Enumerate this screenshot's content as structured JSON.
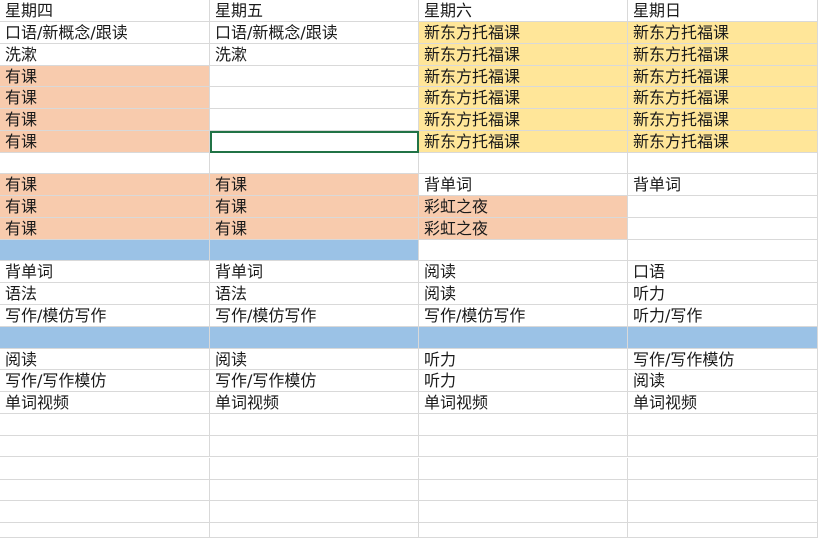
{
  "colors": {
    "orange": "#f8cbad",
    "yellow": "#ffe699",
    "blue": "#9bc2e6",
    "grid": "#d9d9d9"
  },
  "headers": [
    "星期四",
    "星期五",
    "星期六",
    "星期日"
  ],
  "rows": [
    {
      "cells": [
        "口语/新概念/跟读",
        "口语/新概念/跟读",
        "新东方托福课",
        "新东方托福课"
      ],
      "fills": [
        "",
        "",
        "yellow",
        "yellow"
      ]
    },
    {
      "cells": [
        "洗漱",
        "洗漱",
        "新东方托福课",
        "新东方托福课"
      ],
      "fills": [
        "",
        "",
        "yellow",
        "yellow"
      ]
    },
    {
      "cells": [
        "有课",
        "",
        "新东方托福课",
        "新东方托福课"
      ],
      "fills": [
        "orange",
        "",
        "yellow",
        "yellow"
      ]
    },
    {
      "cells": [
        "有课",
        "",
        "新东方托福课",
        "新东方托福课"
      ],
      "fills": [
        "orange",
        "",
        "yellow",
        "yellow"
      ]
    },
    {
      "cells": [
        "有课",
        "",
        "新东方托福课",
        "新东方托福课"
      ],
      "fills": [
        "orange",
        "",
        "yellow",
        "yellow"
      ]
    },
    {
      "cells": [
        "有课",
        "",
        "新东方托福课",
        "新东方托福课"
      ],
      "fills": [
        "orange",
        "",
        "yellow",
        "yellow"
      ]
    },
    {
      "cells": [
        "",
        "",
        "",
        ""
      ],
      "fills": [
        "",
        "",
        "",
        ""
      ]
    },
    {
      "cells": [
        "有课",
        "有课",
        "背单词",
        "背单词"
      ],
      "fills": [
        "orange",
        "orange",
        "",
        ""
      ]
    },
    {
      "cells": [
        "有课",
        "有课",
        "彩虹之夜",
        ""
      ],
      "fills": [
        "orange",
        "orange",
        "orange",
        ""
      ]
    },
    {
      "cells": [
        "有课",
        "有课",
        "彩虹之夜",
        ""
      ],
      "fills": [
        "orange",
        "orange",
        "orange",
        ""
      ]
    },
    {
      "cells": [
        "",
        "",
        "",
        ""
      ],
      "fills": [
        "blue",
        "blue",
        "",
        ""
      ]
    },
    {
      "cells": [
        "背单词",
        "背单词",
        "阅读",
        "口语"
      ],
      "fills": [
        "",
        "",
        "",
        ""
      ]
    },
    {
      "cells": [
        "语法",
        "语法",
        "阅读",
        "听力"
      ],
      "fills": [
        "",
        "",
        "",
        ""
      ]
    },
    {
      "cells": [
        "写作/模仿写作",
        "写作/模仿写作",
        "写作/模仿写作",
        "听力/写作"
      ],
      "fills": [
        "",
        "",
        "",
        ""
      ]
    },
    {
      "cells": [
        "",
        "",
        "",
        ""
      ],
      "fills": [
        "blue",
        "blue",
        "blue",
        "blue"
      ]
    },
    {
      "cells": [
        "阅读",
        "阅读",
        "听力",
        "写作/写作模仿"
      ],
      "fills": [
        "",
        "",
        "",
        ""
      ]
    },
    {
      "cells": [
        "写作/写作模仿",
        "写作/写作模仿",
        "听力",
        "阅读"
      ],
      "fills": [
        "",
        "",
        "",
        ""
      ]
    },
    {
      "cells": [
        "单词视频",
        "单词视频",
        "单词视频",
        "单词视频"
      ],
      "fills": [
        "",
        "",
        "",
        ""
      ]
    },
    {
      "cells": [
        "",
        "",
        "",
        ""
      ],
      "fills": [
        "",
        "",
        "",
        ""
      ]
    },
    {
      "cells": [
        "",
        "",
        "",
        ""
      ],
      "fills": [
        "",
        "",
        "",
        ""
      ]
    },
    {
      "cells": [
        "",
        "",
        "",
        ""
      ],
      "fills": [
        "",
        "",
        "",
        ""
      ]
    },
    {
      "cells": [
        "",
        "",
        "",
        ""
      ],
      "fills": [
        "",
        "",
        "",
        ""
      ]
    },
    {
      "cells": [
        "",
        "",
        "",
        ""
      ],
      "fills": [
        "",
        "",
        "",
        ""
      ]
    },
    {
      "cells": [
        "",
        "",
        "",
        ""
      ],
      "fills": [
        "",
        "",
        "",
        ""
      ]
    }
  ]
}
